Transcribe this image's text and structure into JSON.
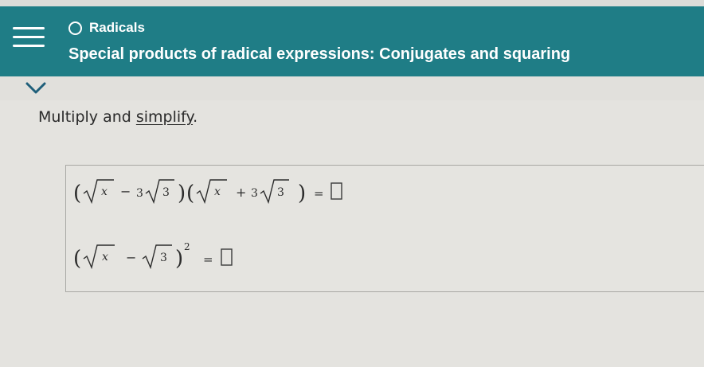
{
  "header": {
    "topic": "Radicals",
    "subtitle": "Special products of radical expressions: Conjugates and squaring"
  },
  "instruction": {
    "before": "Multiply and ",
    "link": "simplify",
    "after": "."
  },
  "problems": {
    "p1": {
      "terms": [
        "x",
        "3",
        "3",
        "x",
        "3",
        "3"
      ],
      "ops": [
        "−",
        "+",
        "="
      ]
    },
    "p2": {
      "terms": [
        "x",
        "3"
      ],
      "ops": [
        "−",
        "="
      ],
      "exponent": "2"
    }
  },
  "colors": {
    "header_bg": "#1f7d86",
    "page_bg": "#e4e3df",
    "text": "#2a2a2a"
  },
  "icons": {
    "menu": "hamburger-icon",
    "topic": "circle-icon",
    "collapse": "chevron-down-icon"
  }
}
